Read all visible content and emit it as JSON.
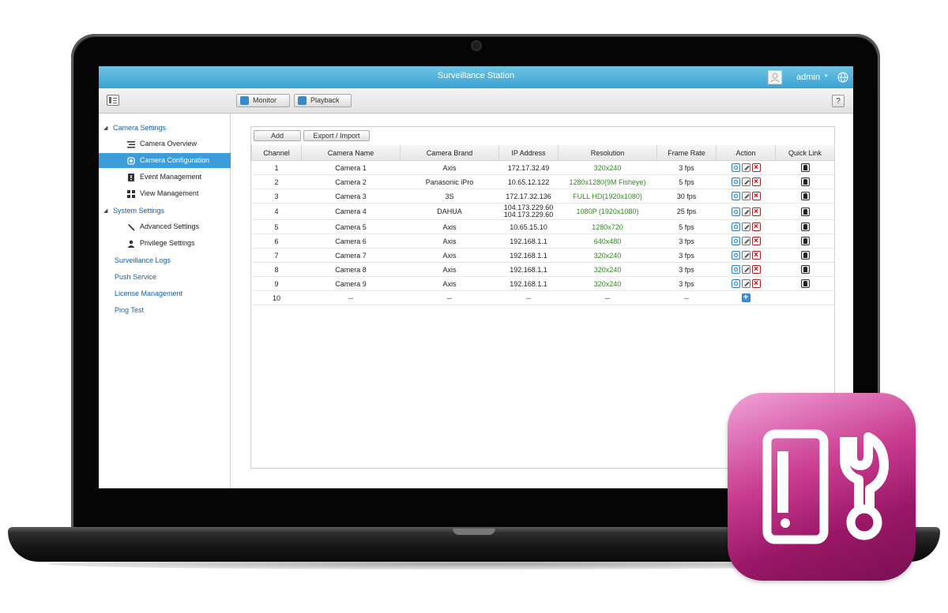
{
  "app": {
    "title": "Surveillance Station",
    "user": "admin",
    "user_caret": "▾"
  },
  "toolbar": {
    "monitor_label": "Monitor",
    "playback_label": "Playback",
    "help_label": "?"
  },
  "sidebar": {
    "camera_settings": "Camera Settings",
    "camera_overview": "Camera Overview",
    "camera_configuration": "Camera Configuration",
    "event_management": "Event Management",
    "view_management": "View Management",
    "system_settings": "System Settings",
    "advanced_settings": "Advanced Settings",
    "privilege_settings": "Privilege Settings",
    "surveillance_logs": "Surveillance Logs",
    "push_service": "Push Service",
    "license_management": "License Management",
    "ping_test": "Ping Test"
  },
  "content": {
    "add_label": "Add",
    "export_import_label": "Export / Import",
    "columns": [
      "Channel",
      "Camera Name",
      "Camera Brand",
      "IP Address",
      "Resolution",
      "Frame Rate",
      "Action",
      "Quick Link"
    ],
    "rows": [
      {
        "channel": "1",
        "name": "Camera 1",
        "brand": "Axis",
        "ip": "172.17.32.49",
        "resolution": "320x240",
        "fps": "3 fps"
      },
      {
        "channel": "2",
        "name": "Camera 2",
        "brand": "Panasonic iPro",
        "ip": "10.65.12.122",
        "resolution": "1280x1280(9M Fisheye)",
        "fps": "5 fps"
      },
      {
        "channel": "3",
        "name": "Camera 3",
        "brand": "3S",
        "ip": "172.17.32.136",
        "resolution": "FULL HD(1920x1080)",
        "fps": "30 fps"
      },
      {
        "channel": "4",
        "name": "Camera 4",
        "brand": "DAHUA",
        "ip": "104.173.229.60",
        "ip2": "104.173.229.60",
        "resolution": "1080P (1920x1080)",
        "fps": "25 fps"
      },
      {
        "channel": "5",
        "name": "Camera 5",
        "brand": "Axis",
        "ip": "10.65.15.10",
        "resolution": "1280x720",
        "fps": "5 fps"
      },
      {
        "channel": "6",
        "name": "Camera 6",
        "brand": "Axis",
        "ip": "192.168.1.1",
        "resolution": "640x480",
        "fps": "3 fps"
      },
      {
        "channel": "7",
        "name": "Camera 7",
        "brand": "Axis",
        "ip": "192.168.1.1",
        "resolution": "320x240",
        "fps": "3 fps"
      },
      {
        "channel": "8",
        "name": "Camera 8",
        "brand": "Axis",
        "ip": "192.168.1.1",
        "resolution": "320x240",
        "fps": "3 fps"
      },
      {
        "channel": "9",
        "name": "Camera 9",
        "brand": "Axis",
        "ip": "192.168.1.1",
        "resolution": "320x240",
        "fps": "3 fps"
      }
    ],
    "empty_row": {
      "channel": "10",
      "name": "--",
      "brand": "--",
      "ip": "--",
      "resolution": "--",
      "fps": "--"
    }
  },
  "icons": {
    "menu": "menu-icon",
    "monitor": "monitor-icon",
    "playback": "playback-icon",
    "globe": "globe-icon",
    "app": "surveillance-tools-app-icon"
  },
  "colors": {
    "titlebar": "#3aa3d3",
    "active_nav": "#3d9ddb",
    "nav_link": "#1a5ea8",
    "resolution_text": "#2f8a1f",
    "app_icon": "#9a1767"
  }
}
